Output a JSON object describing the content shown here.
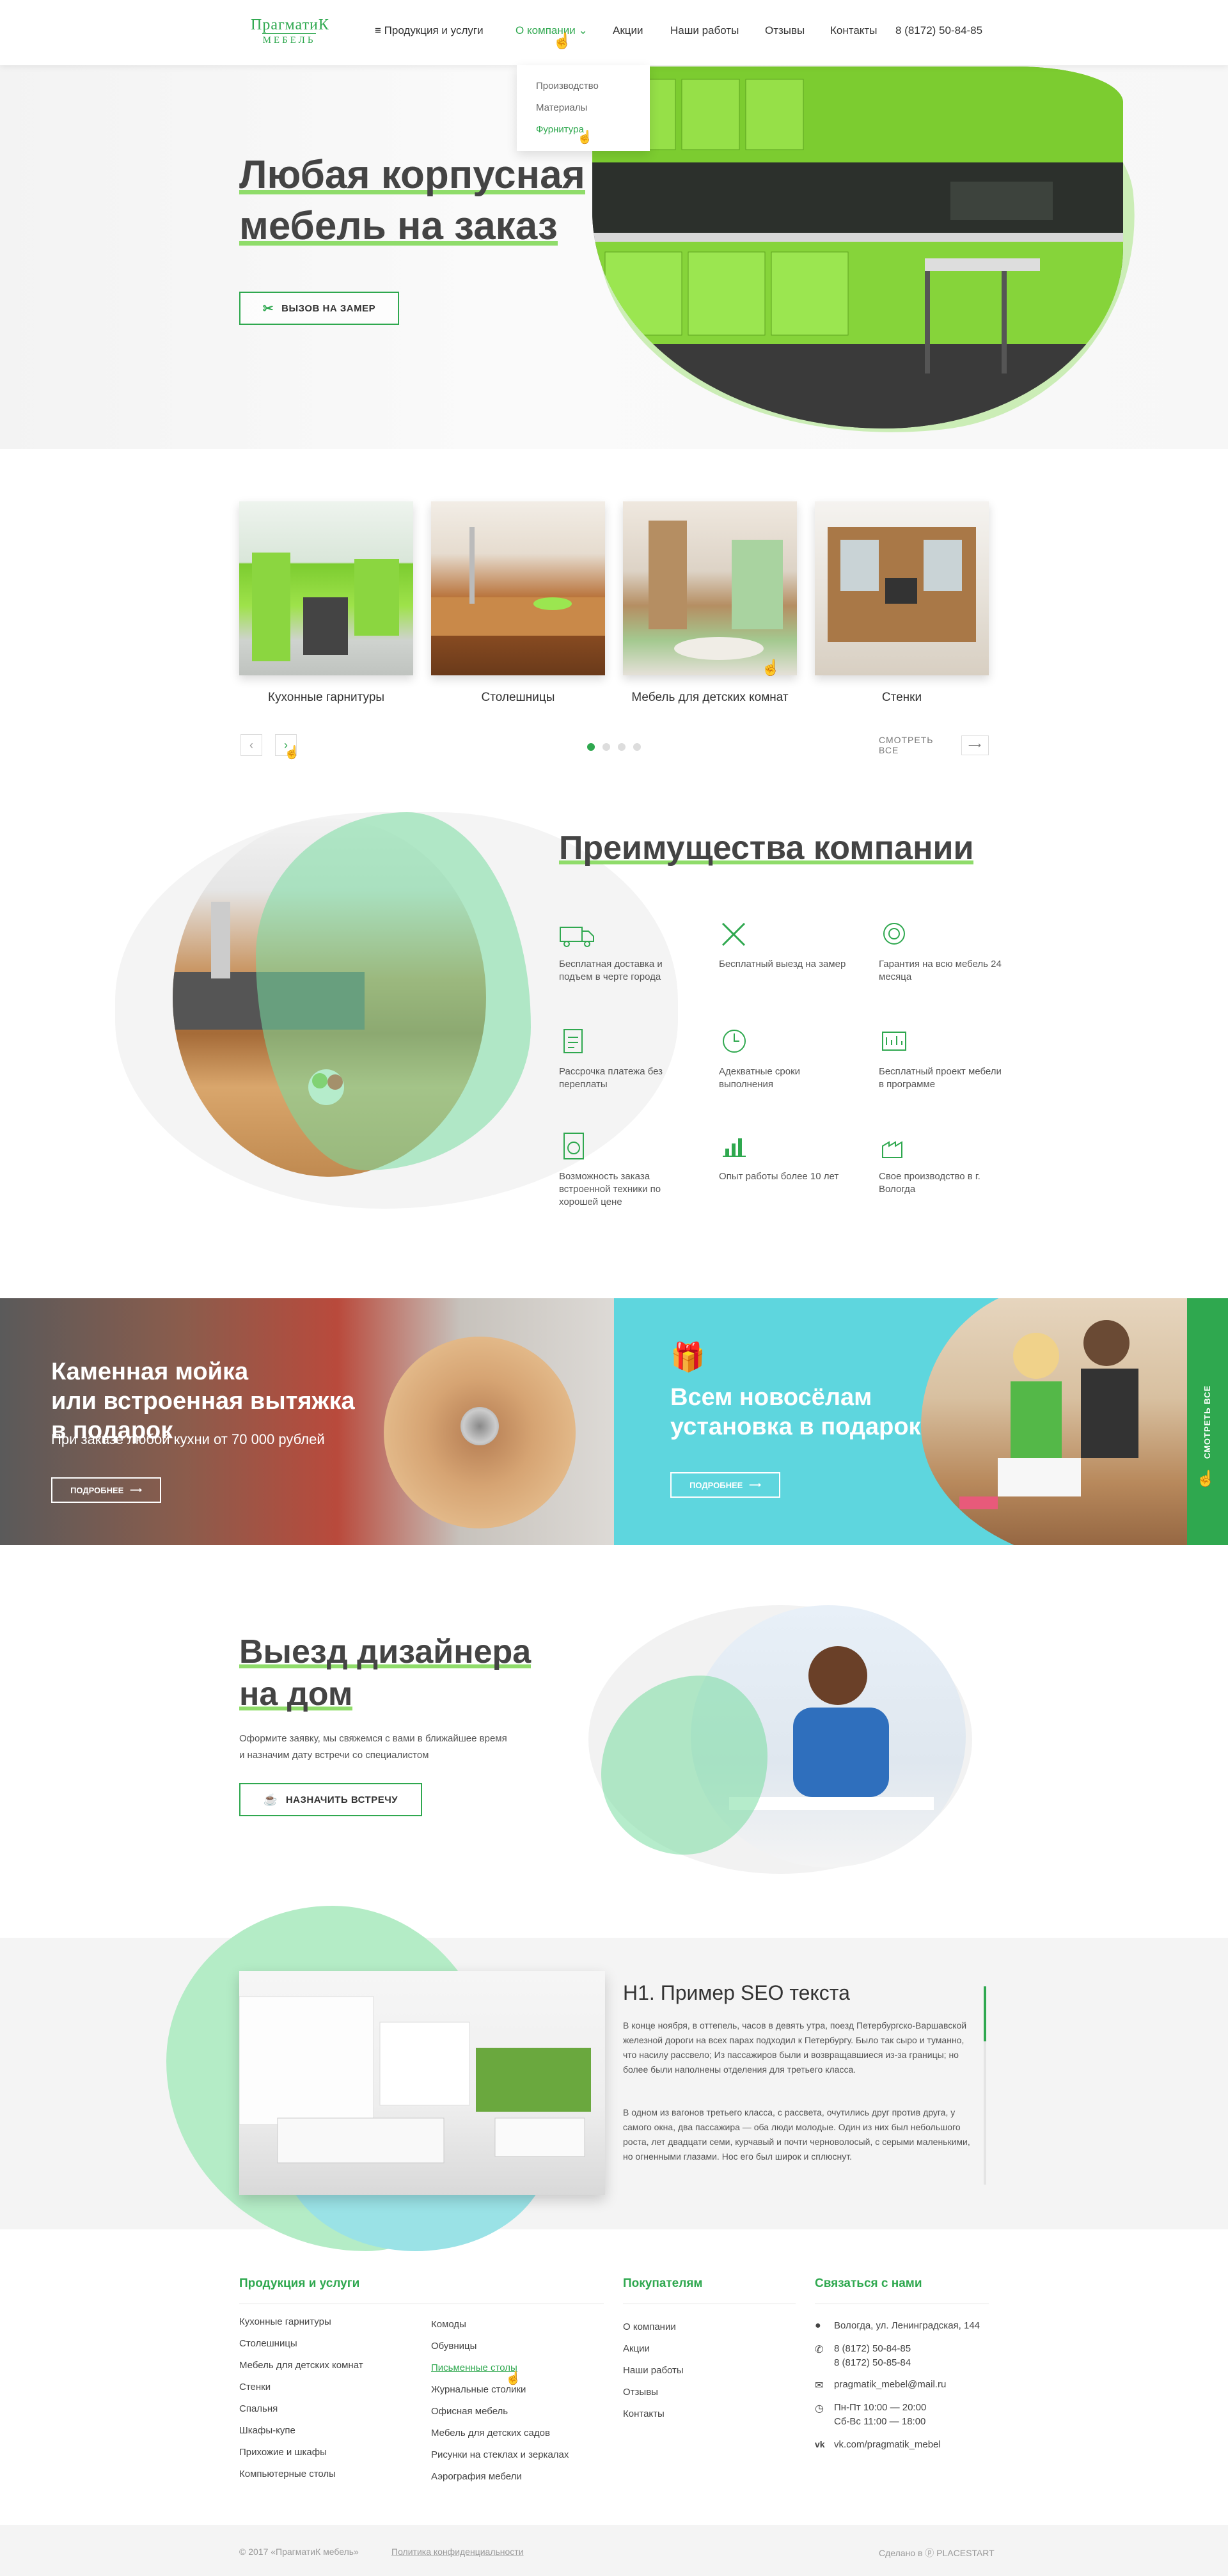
{
  "header": {
    "logo_top": "ПрагматиК",
    "logo_bottom": "МЕБЕЛЬ",
    "nav": [
      "≡ Продукция и услуги",
      "О компании ⌄",
      "Акции",
      "Наши работы",
      "Отзывы",
      "Контакты"
    ],
    "phone": "8 (8172) 50-84-85",
    "dropdown": [
      "Производство",
      "Материалы",
      "Фурнитура"
    ]
  },
  "hero": {
    "title_1": "Любая корпусная",
    "title_2": "мебель на заказ",
    "button": "Вызов на замер"
  },
  "categories": {
    "items": [
      "Кухонные гарнитуры",
      "Столешницы",
      "Мебель для детских комнат",
      "Стенки"
    ],
    "see_all": "Смотреть все",
    "prev": "‹",
    "next": "›"
  },
  "advantages": {
    "title": "Преимущества компании",
    "items": [
      "Бесплатная доставка и подъем в черте города",
      "Бесплатный выезд на замер",
      "Гарантия на всю мебель 24 месяца",
      "Рассрочка платежа без переплаты",
      "Адекватные сроки выполнения",
      "Бесплатный проект мебели в программе",
      "Возможность заказа встроенной техники по хорошей цене",
      "Опыт работы более 10 лет",
      "Свое производство в г. Вологда"
    ]
  },
  "promo_left": {
    "title_1": "Каменная мойка",
    "title_2": "или встроенная вытяжка",
    "title_3": "в подарок",
    "subtitle": "При заказе любой кухни от 70 000 рублей",
    "button": "Подробнее"
  },
  "promo_right": {
    "title_1": "Всем новосёлам",
    "title_2": "установка в подарок",
    "button": "Подробнее",
    "side_tab": "Смотреть все"
  },
  "designer": {
    "title_1": "Выезд дизайнера",
    "title_2": "на дом",
    "text_1": "Оформите заявку, мы свяжемся с вами в ближайшее время",
    "text_2": "и назначим дату встречи со специалистом",
    "button": "Назначить встречу"
  },
  "seo": {
    "title": "H1. Пример SEO текста",
    "p1": "В конце ноября, в оттепель, часов в девять утра, поезд Петербургско-Варшавской железной дороги на всех парах подходил к Петербургу. Было так сыро и туманно, что насилу рассвело; Из пассажиров были и возвращавшиеся из-за границы; но более были наполнены отделения для третьего класса.",
    "p2": "В одном из вагонов третьего класса, с рассвета, очутились друг против друга, у самого окна, два пассажира — оба люди молодые. Один из них был небольшого роста, лет двадцати семи, курчавый и почти черноволосый, с серыми маленькими, но огненными глазами. Нос его был широк и сплюснут."
  },
  "footer": {
    "col1_title": "Продукция и услуги",
    "col1a": [
      "Кухонные гарнитуры",
      "Столешницы",
      "Мебель для детских комнат",
      "Стенки",
      "Спальня",
      "Шкафы-купе",
      "Прихожие и шкафы",
      "Компьютерные столы"
    ],
    "col1b": [
      "Комоды",
      "Обувницы",
      "Письменные столы",
      "Журнальные столики",
      "Офисная мебель",
      "Мебель для детских садов",
      "Рисунки на стеклах и зеркалах",
      "Аэрография мебели"
    ],
    "col2_title": "Покупателям",
    "col2": [
      "О компании",
      "Акции",
      "Наши работы",
      "Отзывы",
      "Контакты"
    ],
    "col3_title": "Связаться с нами",
    "address": "Вологда, ул. Ленинградская, 144",
    "phone1": "8 (8172) 50-84-85",
    "phone2": "8 (8172) 50-85-84",
    "email": "pragmatik_mebel@mail.ru",
    "hours1": "Пн-Пт  10:00 — 20:00",
    "hours2": "Сб-Вс  11:00 — 18:00",
    "vk": "vk.com/pragmatik_mebel",
    "copyright": "© 2017 «ПрагматиК мебель»",
    "privacy": "Политика конфиденциальности",
    "made_by": "Сделано в ⓟ PLACESTART"
  },
  "colors": {
    "accent": "#2fa84f",
    "promo_blue": "#5ed6de",
    "light_green": "#8fdc6a"
  }
}
